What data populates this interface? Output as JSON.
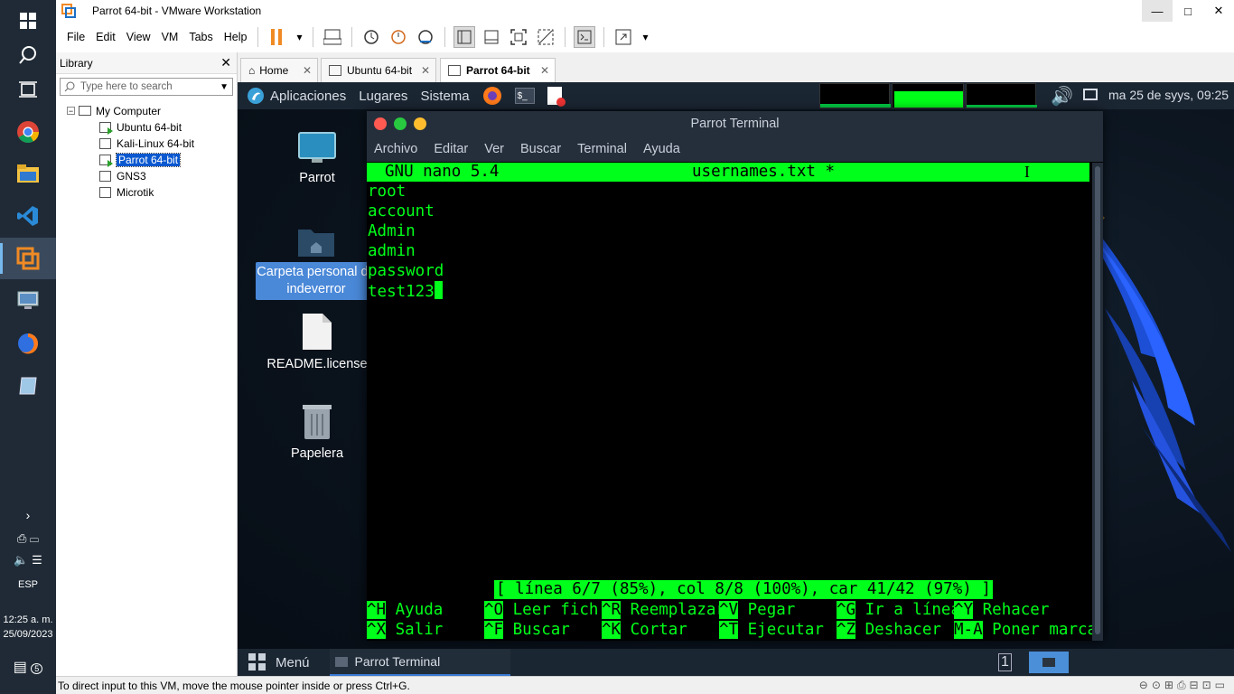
{
  "window": {
    "title": "Parrot 64-bit - VMware Workstation",
    "min": "—",
    "max": "□",
    "close": "✕"
  },
  "menubar": {
    "items": [
      "File",
      "Edit",
      "View",
      "VM",
      "Tabs",
      "Help"
    ]
  },
  "library": {
    "title": "Library",
    "close": "✕",
    "search_placeholder": "Type here to search",
    "root": "My Computer",
    "vms": [
      "Ubuntu 64-bit",
      "Kali-Linux 64-bit",
      "Parrot 64-bit",
      "GNS3",
      "Microtik"
    ]
  },
  "tabs": [
    {
      "label": "Home"
    },
    {
      "label": "Ubuntu 64-bit"
    },
    {
      "label": "Parrot 64-bit"
    }
  ],
  "guest": {
    "panel": {
      "apps": "Aplicaciones",
      "places": "Lugares",
      "system": "Sistema",
      "clock": "ma 25 de syys, 09:25"
    },
    "desktop": [
      {
        "label": "Parrot"
      },
      {
        "label": "Carpeta personal de",
        "label2": "indeverror"
      },
      {
        "label": "README.license"
      },
      {
        "label": "Papelera"
      }
    ],
    "bottom": {
      "menu": "Menú",
      "task": "Parrot Terminal"
    }
  },
  "terminal": {
    "title": "Parrot Terminal",
    "menu": [
      "Archivo",
      "Editar",
      "Ver",
      "Buscar",
      "Terminal",
      "Ayuda"
    ],
    "nano_version": "GNU nano 5.4",
    "filename": "usernames.txt *",
    "cursor_mark": "I",
    "lines": [
      "root",
      "account",
      "Admin",
      "admin",
      "password",
      "test123"
    ],
    "status": "[ línea 6/7 (85%), col 8/8 (100%), car 41/42 (97%) ]",
    "shortcuts_row1": [
      {
        "key": "^H",
        "label": "Ayuda"
      },
      {
        "key": "^O",
        "label": "Leer fich."
      },
      {
        "key": "^R",
        "label": "Reemplazar"
      },
      {
        "key": "^V",
        "label": "Pegar"
      },
      {
        "key": "^G",
        "label": "Ir a línea"
      },
      {
        "key": "^Y",
        "label": "Rehacer"
      }
    ],
    "shortcuts_row2": [
      {
        "key": "^X",
        "label": "Salir"
      },
      {
        "key": "^F",
        "label": "Buscar"
      },
      {
        "key": "^K",
        "label": "Cortar"
      },
      {
        "key": "^T",
        "label": "Ejecutar"
      },
      {
        "key": "^Z",
        "label": "Deshacer"
      },
      {
        "key": "M-A",
        "label": "Poner marca"
      }
    ]
  },
  "win_taskbar": {
    "lang": "ESP",
    "time": "12:25 a. m.",
    "date": "25/09/2023",
    "notif_count": "5"
  },
  "statusbar": {
    "text": "To direct input to this VM, move the mouse pointer inside or press Ctrl+G."
  },
  "colors": {
    "nano_green": "#00ff1a",
    "selection_blue": "#0a58d0",
    "terminal_bg": "#000000"
  }
}
